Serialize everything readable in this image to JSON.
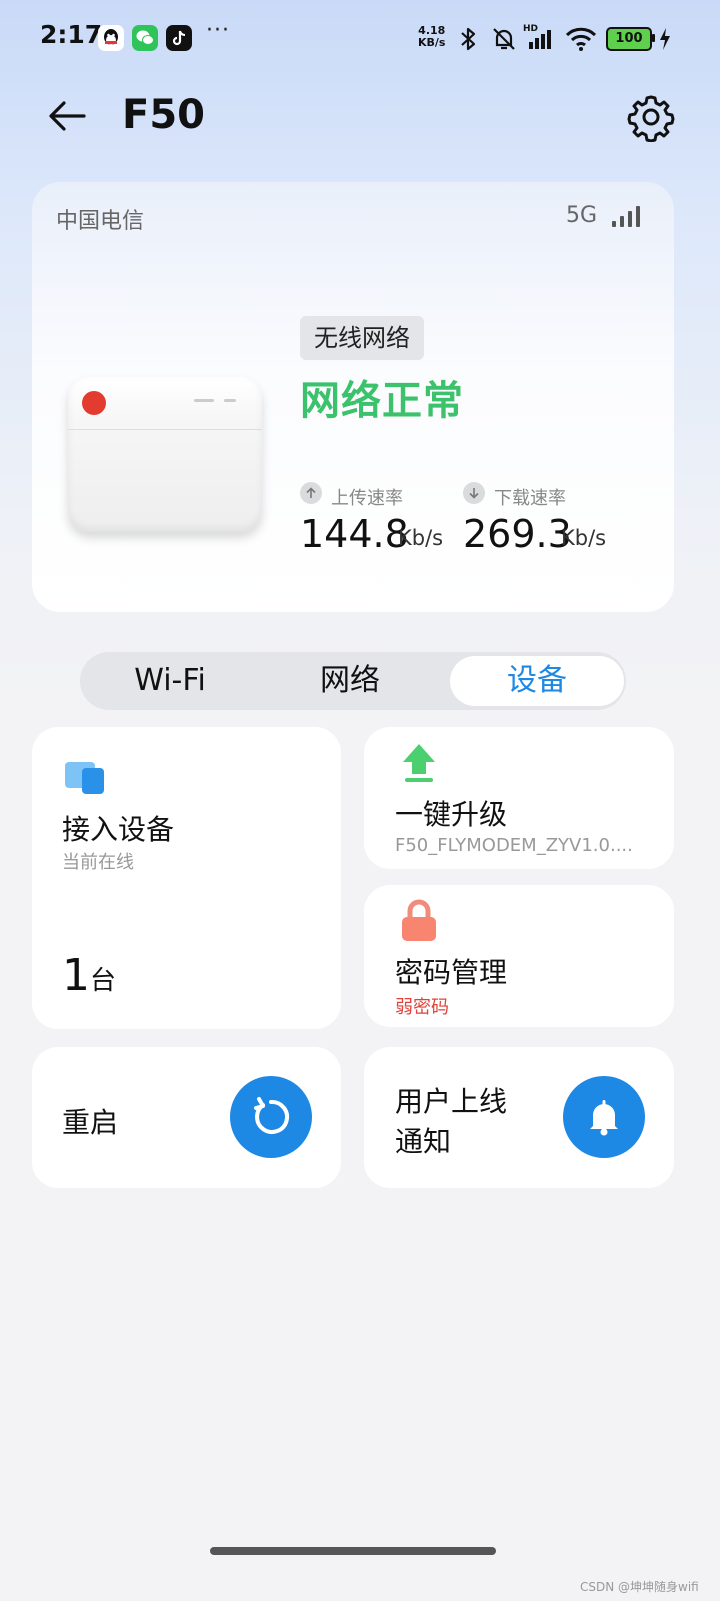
{
  "status_bar": {
    "time": "2:17",
    "net_speed_value": "4.18",
    "net_speed_unit": "KB/s",
    "more": "···",
    "hd_label": "HD",
    "battery": "100",
    "icons": [
      "qq-icon",
      "wechat-icon",
      "tiktok-icon",
      "bluetooth-icon",
      "mute-bell-icon",
      "cellular-signal-icon",
      "wifi-icon",
      "battery-icon",
      "charging-icon"
    ]
  },
  "header": {
    "title": "F50"
  },
  "device_card": {
    "carrier": "中国电信",
    "network_gen": "5G",
    "connection_tag": "无线网络",
    "status": "网络正常",
    "status_color": "#3cc26c",
    "upload": {
      "label": "上传速率",
      "value": "144.8",
      "unit": "Kb/s"
    },
    "download": {
      "label": "下载速率",
      "value": "269.3",
      "unit": "Kb/s"
    }
  },
  "tabs": [
    {
      "label": "Wi-Fi",
      "active": false
    },
    {
      "label": "网络",
      "active": false
    },
    {
      "label": "设备",
      "active": true
    }
  ],
  "tiles": {
    "connected": {
      "title": "接入设备",
      "subtitle": "当前在线",
      "count": "1",
      "count_unit": "台"
    },
    "upgrade": {
      "title": "一键升级",
      "subtitle": "F50_FLYMODEM_ZYV1.0...."
    },
    "password": {
      "title": "密码管理",
      "subtitle": "弱密码"
    },
    "reboot": {
      "title": "重启"
    },
    "notify": {
      "title_line1": "用户上线",
      "title_line2": "通知"
    }
  },
  "colors": {
    "accent": "#1e88e5",
    "success": "#3cc26c",
    "warning": "#e0433a"
  },
  "watermark": "CSDN @坤坤随身wifi"
}
